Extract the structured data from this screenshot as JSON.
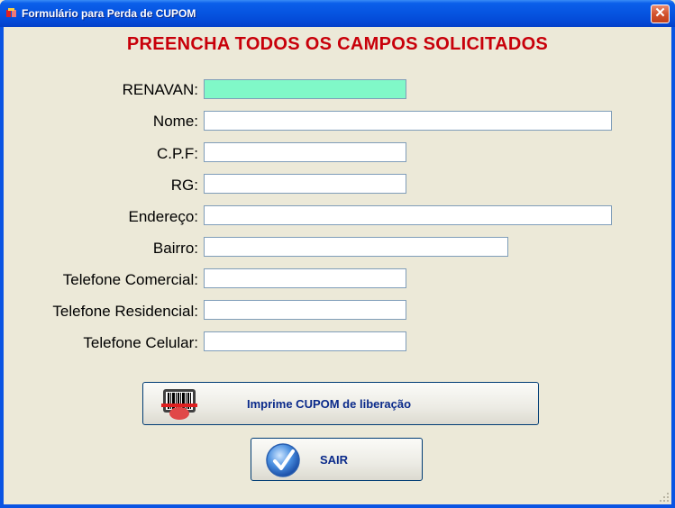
{
  "window": {
    "title": "Formulário para Perda de CUPOM",
    "close_glyph": "✕"
  },
  "heading": "PREENCHA TODOS OS CAMPOS SOLICITADOS",
  "fields": [
    {
      "label": "RENAVAN:",
      "value": ""
    },
    {
      "label": "Nome:",
      "value": ""
    },
    {
      "label": "C.P.F:",
      "value": ""
    },
    {
      "label": "RG:",
      "value": ""
    },
    {
      "label": "Endereço:",
      "value": ""
    },
    {
      "label": "Bairro:",
      "value": ""
    },
    {
      "label": "Telefone Comercial:",
      "value": ""
    },
    {
      "label": "Telefone Residencial:",
      "value": ""
    },
    {
      "label": "Telefone Celular:",
      "value": ""
    }
  ],
  "buttons": {
    "print": {
      "label": "Imprime CUPOM de liberação",
      "icon": "barcode-scanner-icon"
    },
    "exit": {
      "label": "SAIR",
      "icon": "checkmark-icon"
    }
  },
  "colors": {
    "heading": "#c8000a",
    "active_field": "#80f8c8",
    "button_text": "#0a2a8a"
  }
}
